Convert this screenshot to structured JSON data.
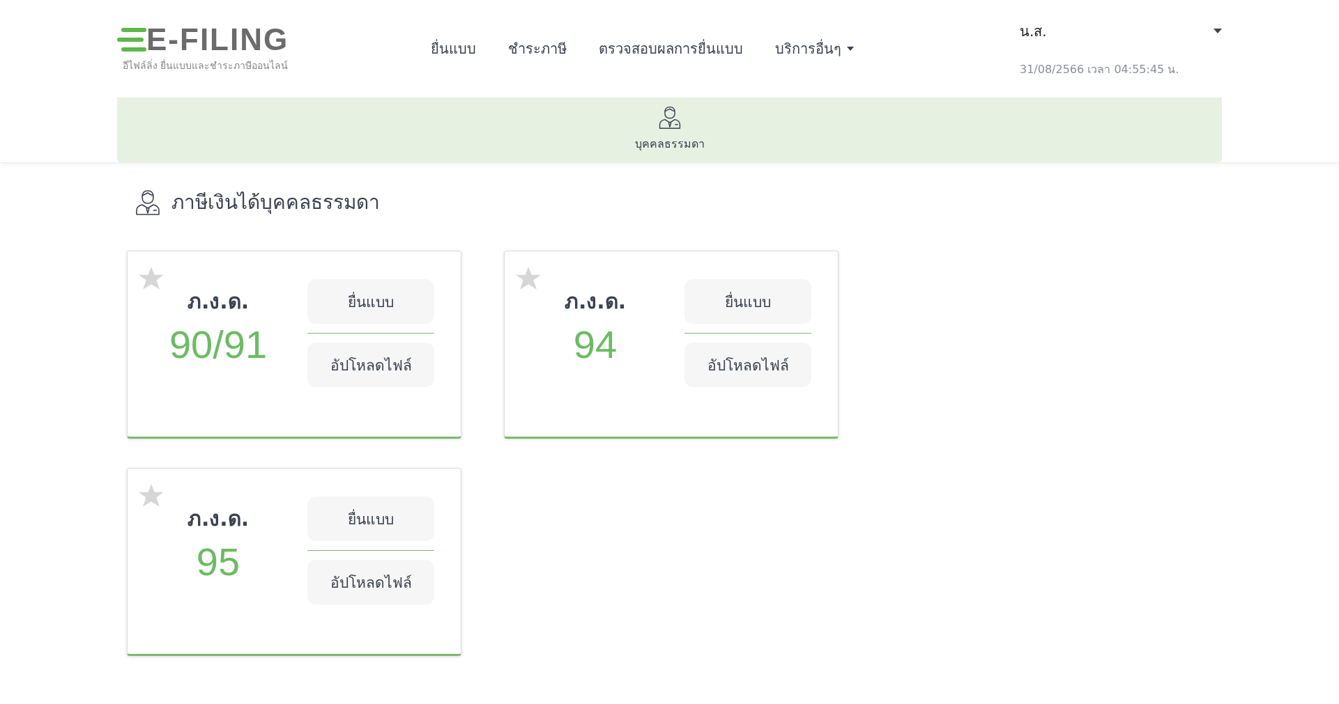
{
  "header": {
    "logo": {
      "title": "E-FILING",
      "subtitle": "อีไฟล์ลิ่ง ยื่นแบบและชำระภาษีออนไลน์"
    },
    "nav": [
      {
        "label": "ยื่นแบบ",
        "dropdown": false
      },
      {
        "label": "ชำระภาษี",
        "dropdown": false
      },
      {
        "label": "ตรวจสอบผลการยื่นแบบ",
        "dropdown": false
      },
      {
        "label": "บริการอื่นๆ",
        "dropdown": true
      }
    ],
    "user": {
      "name": "น.ส.",
      "datetime": "31/08/2566 เวลา 04:55:45 น."
    }
  },
  "taxpayer_tabs": [
    {
      "label": "บุคคลธรรมดา",
      "selected": true
    }
  ],
  "section": {
    "title": "ภาษีเงินได้บุคคลธรรมดา"
  },
  "forms": [
    {
      "label": "ภ.ง.ด.",
      "number": "90/91",
      "favorite": false,
      "buttons": [
        "ยื่นแบบ",
        "อัปโหลดไฟล์"
      ]
    },
    {
      "label": "ภ.ง.ด.",
      "number": "94",
      "favorite": false,
      "buttons": [
        "ยื่นแบบ",
        "อัปโหลดไฟล์"
      ]
    },
    {
      "label": "ภ.ง.ด.",
      "number": "95",
      "favorite": false,
      "buttons": [
        "ยื่นแบบ",
        "อัปโหลดไฟล์"
      ]
    }
  ]
}
